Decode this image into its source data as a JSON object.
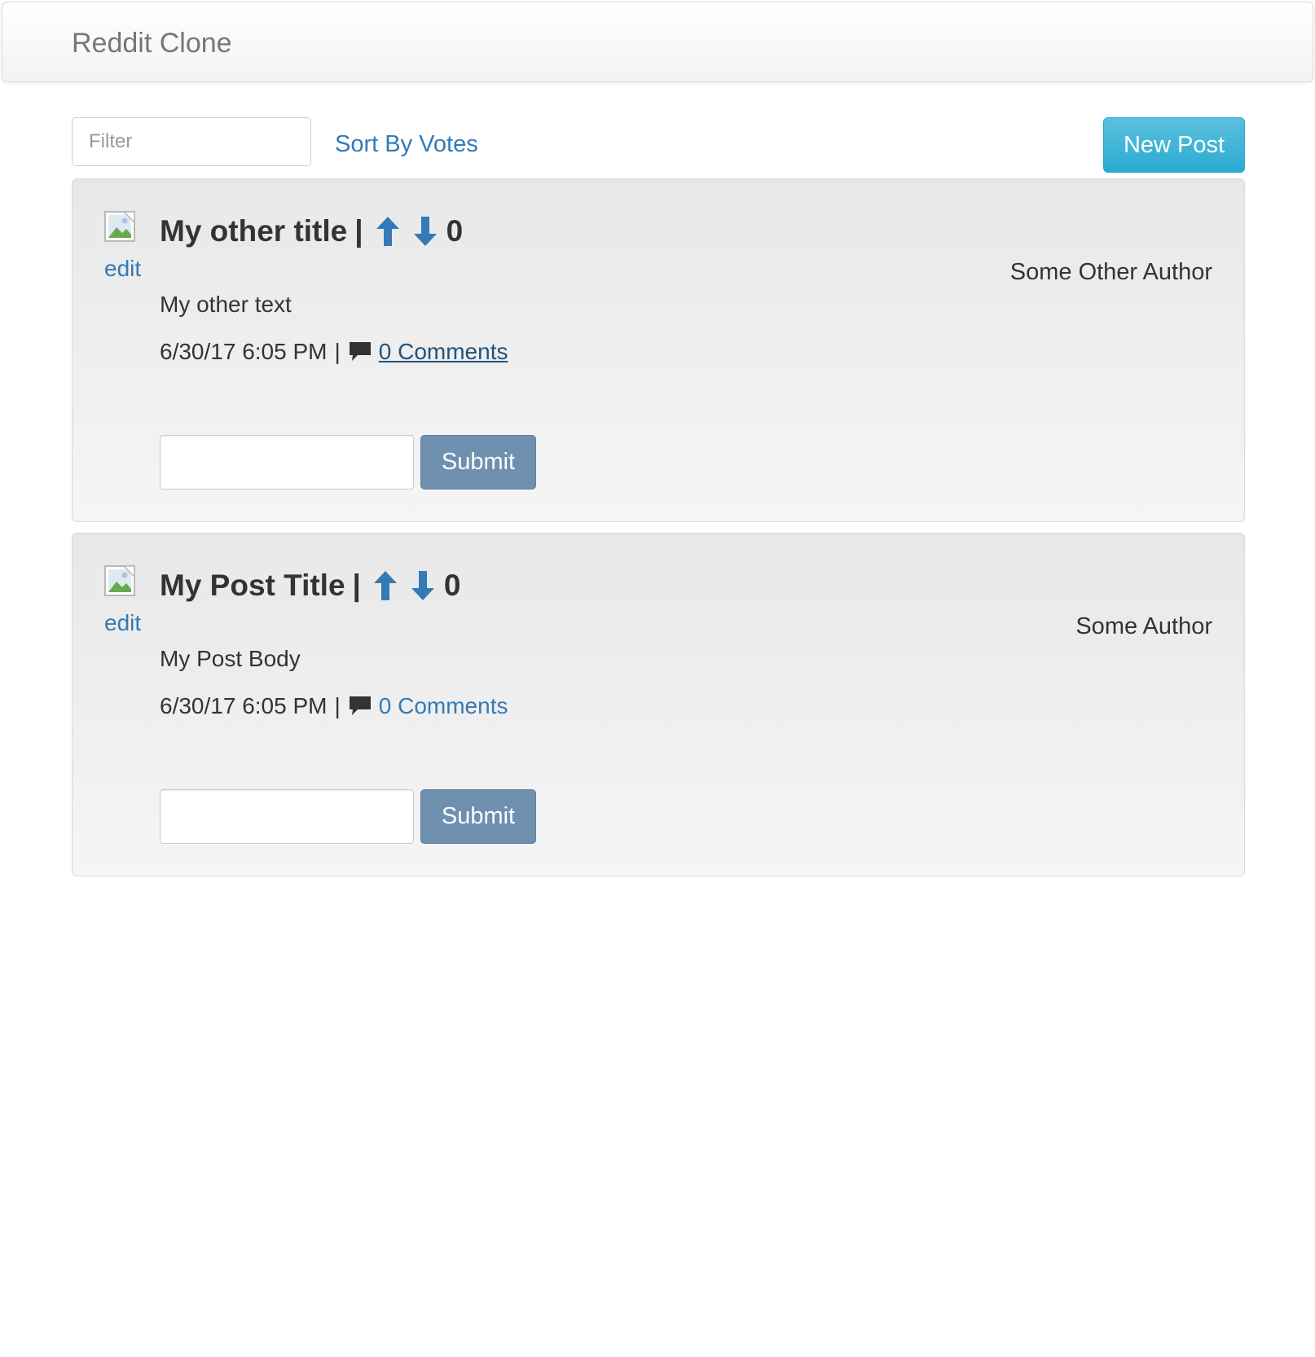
{
  "navbar": {
    "brand": "Reddit Clone"
  },
  "toolbar": {
    "filter_placeholder": "Filter",
    "filter_value": "",
    "sort_label": "Sort By Votes",
    "new_post_label": "New Post"
  },
  "colors": {
    "link": "#337ab7",
    "link_visited": "#23527c",
    "info_button": "#5bc0de",
    "submit_button": "#6f8fae",
    "panel_bg": "#eeeeee"
  },
  "posts": [
    {
      "title": "My other title",
      "title_separator": "|",
      "votes": "0",
      "upvote_icon": "arrow-up-icon",
      "downvote_icon": "arrow-down-icon",
      "edit_label": "edit",
      "thumbnail_icon": "broken-image-icon",
      "author": "Some Other Author",
      "body": "My other text",
      "timestamp": "6/30/17 6:05 PM",
      "meta_separator": "|",
      "comment_icon": "comment-icon",
      "comments_label": "0 Comments",
      "comment_input_value": "",
      "submit_label": "Submit"
    },
    {
      "title": "My Post Title",
      "title_separator": "|",
      "votes": "0",
      "upvote_icon": "arrow-up-icon",
      "downvote_icon": "arrow-down-icon",
      "edit_label": "edit",
      "thumbnail_icon": "broken-image-icon",
      "author": "Some Author",
      "body": "My Post Body",
      "timestamp": "6/30/17 6:05 PM",
      "meta_separator": "|",
      "comment_icon": "comment-icon",
      "comments_label": "0 Comments",
      "comment_input_value": "",
      "submit_label": "Submit"
    }
  ]
}
